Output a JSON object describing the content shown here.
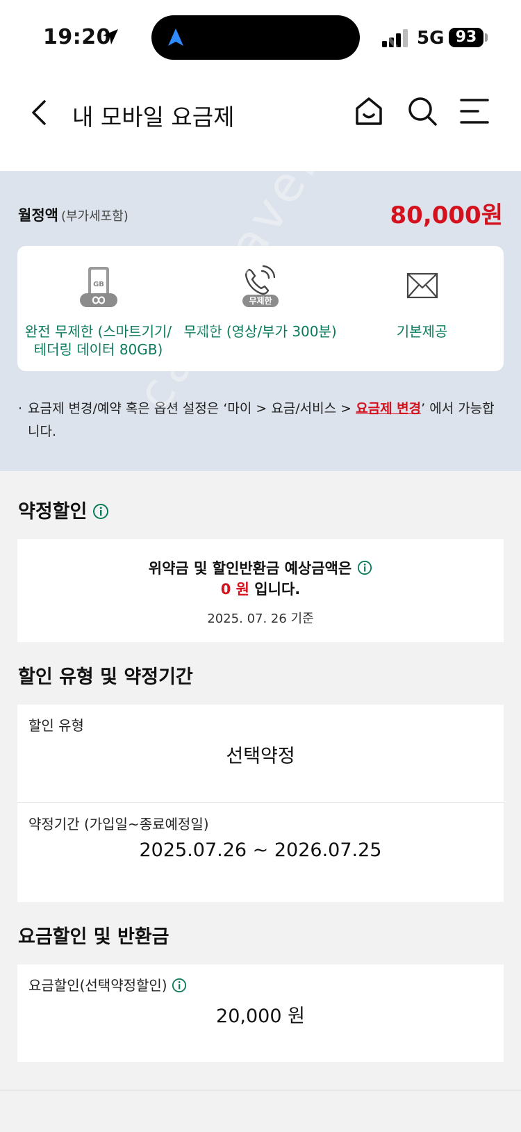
{
  "status_bar": {
    "time": "19:20",
    "network": "5G",
    "battery": "93"
  },
  "header": {
    "title": "내 모바일 요금제",
    "icons": [
      "chevron-left-icon",
      "home-icon",
      "search-icon",
      "menu-icon"
    ]
  },
  "plan": {
    "fee_label": "월정액",
    "fee_sub": "(부가세포함)",
    "fee_amount": "80,000원",
    "features": [
      {
        "icon": "data-unlimited-icon",
        "badge": "GB",
        "line1": "완전 무제한 (스마트기기/",
        "line2": "테더링 데이터 80GB)"
      },
      {
        "icon": "call-unlimited-icon",
        "badge": "무제한",
        "line1": "무제한 (영상/부가 300분)",
        "line2": ""
      },
      {
        "icon": "mail-icon",
        "line1": "기본제공",
        "line2": ""
      }
    ],
    "notice_bullet": "·",
    "notice_pre": "요금제 변경/예약 혹은 옵션 설정은 ‘마이 > 요금/서비스 > ",
    "notice_link": "요금제 변경",
    "notice_post": "’ 에서 가능합니다."
  },
  "contract": {
    "title": "약정할인",
    "penalty_line1": "위약금 및 할인반환금 예상금액은",
    "penalty_amount": "0 원",
    "penalty_suffix": " 입니다.",
    "penalty_date": "2025. 07. 26 기준"
  },
  "discount_type": {
    "title": "할인 유형 및 약정기간",
    "type_label": "할인 유형",
    "type_value": "선택약정",
    "period_label": "약정기간 (가입일~종료예정일)",
    "period_value": "2025.07.26 ~ 2026.07.25"
  },
  "refund": {
    "title": "요금할인 및 반환금",
    "label": "요금할인(선택약정할인)",
    "value": "20,000 원"
  },
  "colors": {
    "accent_red": "#d4121d",
    "accent_green": "#0a7a5c",
    "plan_bg": "#dde3ec"
  }
}
